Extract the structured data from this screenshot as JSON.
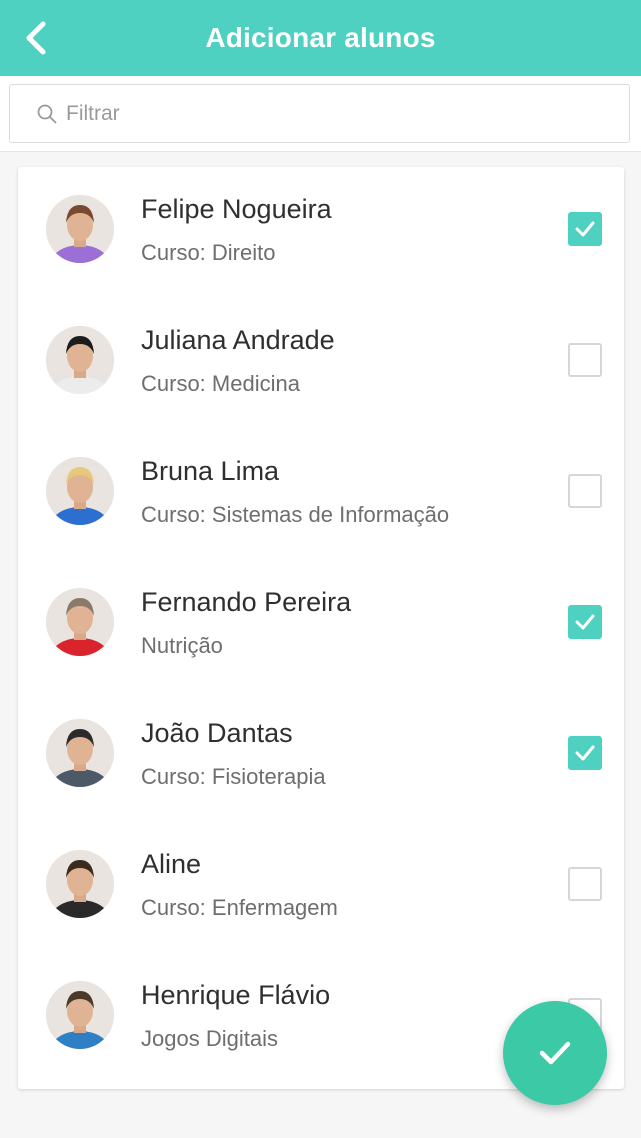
{
  "header": {
    "title": "Adicionar alunos",
    "back_icon": "chevron-left-icon",
    "color": "#4fd1c1"
  },
  "search": {
    "placeholder": "Filtrar",
    "value": "",
    "icon": "search-icon"
  },
  "students": [
    {
      "name": "Felipe Nogueira",
      "course": "Curso: Direito",
      "checked": true,
      "avatar_color": "#7a4a2e",
      "shirt_color": "#9b6fd6"
    },
    {
      "name": "Juliana Andrade",
      "course": "Curso: Medicina",
      "checked": false,
      "avatar_color": "#1c1c1c",
      "shirt_color": "#ececec"
    },
    {
      "name": "Bruna Lima",
      "course": "Curso: Sistemas de Informação",
      "checked": false,
      "avatar_color": "#e8c87a",
      "shirt_color": "#2d6fd0"
    },
    {
      "name": "Fernando Pereira",
      "course": "Nutrição",
      "checked": true,
      "avatar_color": "#8a7a6a",
      "shirt_color": "#d9232d"
    },
    {
      "name": "João Dantas",
      "course": "Curso: Fisioterapia",
      "checked": true,
      "avatar_color": "#2b2b2b",
      "shirt_color": "#4d5968"
    },
    {
      "name": "Aline",
      "course": "Curso: Enfermagem",
      "checked": false,
      "avatar_color": "#3b2a1e",
      "shirt_color": "#2a2a2a"
    },
    {
      "name": "Henrique Flávio",
      "course": "Jogos Digitais",
      "checked": false,
      "avatar_color": "#4a3a2a",
      "shirt_color": "#2e7fc4"
    }
  ],
  "fab": {
    "icon": "check-icon",
    "color": "#3cc9a6"
  }
}
